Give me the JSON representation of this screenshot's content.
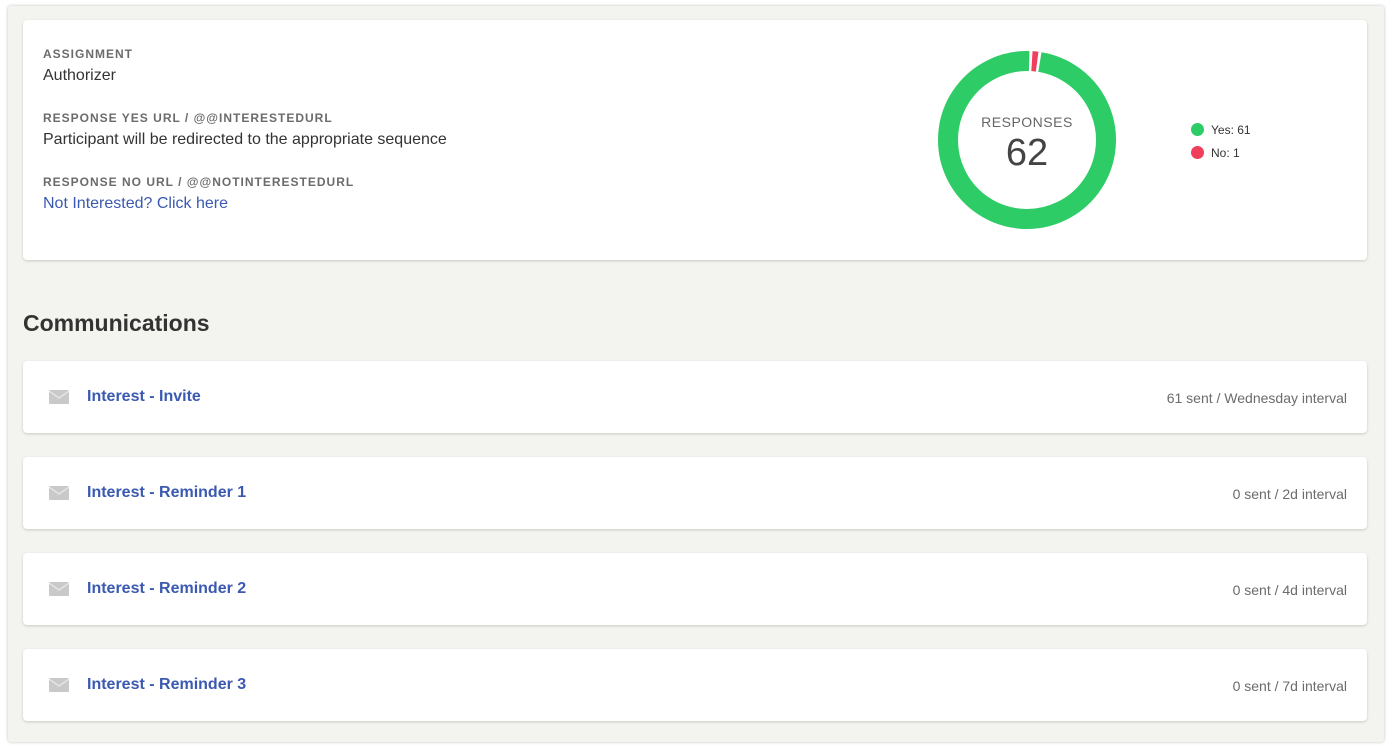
{
  "summary": {
    "assignment_label": "ASSIGNMENT",
    "assignment_value": "Authorizer",
    "yes_url_label": "RESPONSE YES URL / @@INTERESTEDURL",
    "yes_url_value": "Participant will be redirected to the appropriate sequence",
    "no_url_label": "RESPONSE NO URL / @@NOTINTERESTEDURL",
    "no_url_value": "Not Interested? Click here"
  },
  "responses": {
    "title": "RESPONSES",
    "total": "62",
    "legend": [
      {
        "label": "Yes: 61",
        "color": "#2ecc66"
      },
      {
        "label": "No: 1",
        "color": "#f03e5d"
      }
    ]
  },
  "chart_data": {
    "type": "pie",
    "categories": [
      "Yes",
      "No"
    ],
    "values": [
      61,
      1
    ],
    "colors": [
      "#2ecc66",
      "#f03e5d"
    ],
    "title": "RESPONSES",
    "total": 62
  },
  "communications": {
    "title": "Communications",
    "items": [
      {
        "title": "Interest - Invite",
        "meta": "61 sent / Wednesday interval",
        "icon": "envelope-icon"
      },
      {
        "title": "Interest - Reminder 1",
        "meta": "0 sent / 2d interval",
        "icon": "envelope-icon"
      },
      {
        "title": "Interest - Reminder 2",
        "meta": "0 sent / 4d interval",
        "icon": "envelope-icon"
      },
      {
        "title": "Interest - Reminder 3",
        "meta": "0 sent / 7d interval",
        "icon": "envelope-icon"
      }
    ]
  }
}
